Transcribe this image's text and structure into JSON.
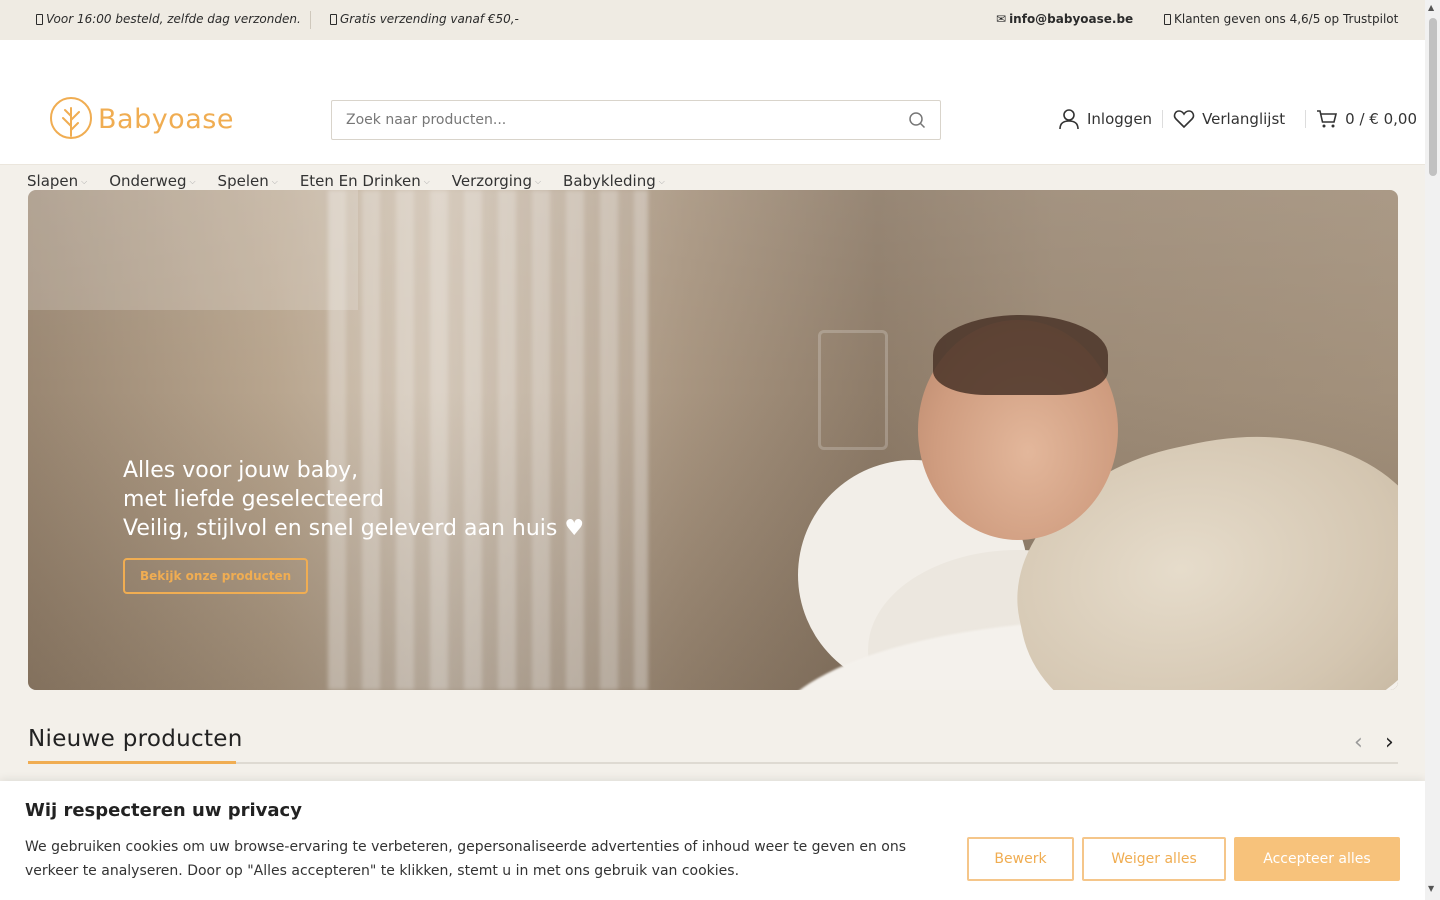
{
  "topbar": {
    "usp1": "Voor 16:00 besteld, zelfde dag verzonden.",
    "usp2": "Gratis verzending vanaf €50,-",
    "mail_icon": "✉",
    "email": "info@babyoase.be",
    "trustpilot": "Klanten geven ons 4,6/5 op Trustpilot"
  },
  "header": {
    "logo": "Babyoase",
    "search_placeholder": "Zoek naar producten...",
    "login": "Inloggen",
    "wishlist": "Verlanglijst",
    "cart": "0 / € 0,00"
  },
  "nav": [
    "Slapen",
    "Onderweg",
    "Spelen",
    "Eten En Drinken",
    "Verzorging",
    "Babykleding"
  ],
  "hero": {
    "line1": "Alles voor jouw baby,",
    "line2": "met liefde geselecteerd",
    "line3": "Veilig, stijlvol en snel geleverd aan huis ♥",
    "button": "Bekijk onze producten"
  },
  "section": {
    "title": "Nieuwe producten"
  },
  "cookie": {
    "title": "Wij respecteren uw privacy",
    "text": "We gebruiken cookies om uw browse-ervaring te verbeteren, gepersonaliseerde advertenties of inhoud weer te geven en ons verkeer te analyseren. Door op \"Alles accepteren\" te klikken, stemt u in met ons gebruik van cookies.",
    "edit": "Bewerk",
    "reject": "Weiger alles",
    "accept": "Accepteer alles"
  },
  "colors": {
    "accent": "#f0ad52",
    "background": "#f3f0ea"
  }
}
